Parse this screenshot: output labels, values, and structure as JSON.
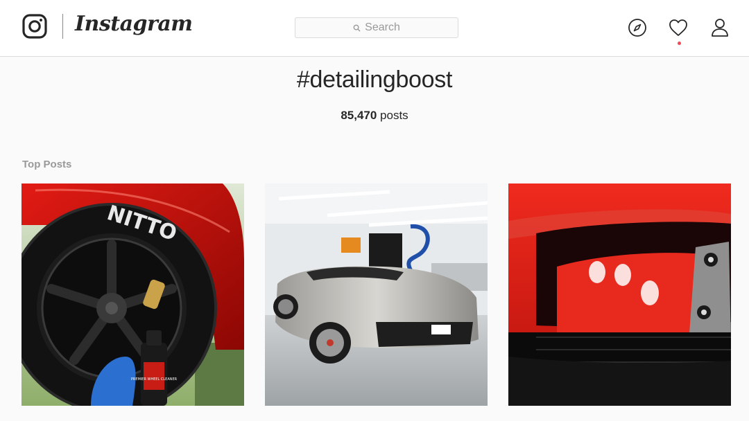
{
  "header": {
    "brand": "Instagram",
    "search": {
      "placeholder": "Search"
    },
    "notification_dot_color": "#ed4956",
    "icons": [
      "instagram-logo-icon",
      "search-icon",
      "compass-icon",
      "heart-icon",
      "profile-icon"
    ]
  },
  "hashtag": {
    "title": "#detailingboost",
    "post_count": "85,470",
    "post_count_suffix": " posts"
  },
  "section": {
    "title": "Top Posts"
  },
  "posts": [
    {
      "subject": "red car wheel with Nitto tire and cleaner bottle",
      "bottle_label": "PREMIER WHEEL CLEANER"
    },
    {
      "subject": "silver Lamborghini in detailing garage"
    },
    {
      "subject": "red car rear bumper close-up"
    }
  ],
  "colors": {
    "background": "#fafafa",
    "header_bg": "#ffffff",
    "border": "#dbdbdb",
    "text": "#262626",
    "muted": "#999999",
    "accent_red": "#ed4956"
  }
}
